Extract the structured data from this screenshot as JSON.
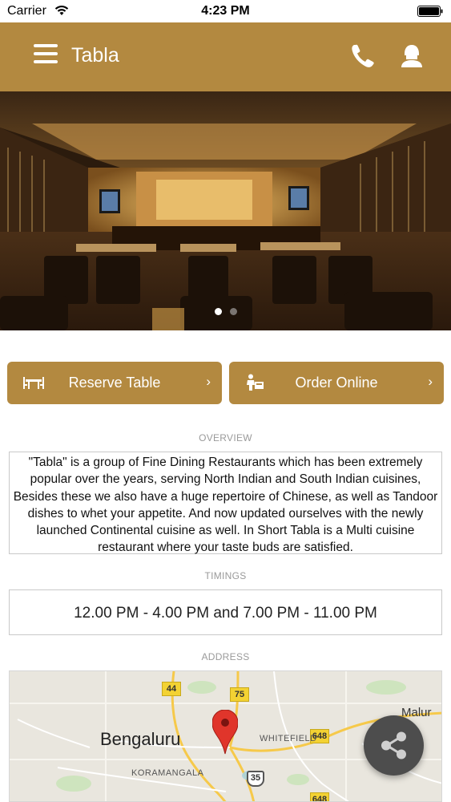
{
  "status_bar": {
    "carrier": "Carrier",
    "time": "4:23 PM"
  },
  "header": {
    "title": "Tabla",
    "icons": {
      "menu": "hamburger-menu-icon",
      "phone": "phone-icon",
      "profile": "profile-icon"
    }
  },
  "hero": {
    "slides": 2,
    "active_slide": 1
  },
  "actions": {
    "reserve_label": "Reserve Table",
    "order_label": "Order Online",
    "chevron": "›"
  },
  "sections": {
    "overview_label": "OVERVIEW",
    "overview_text": "\"Tabla\" is a group of Fine Dining Restaurants which has been extremely popular over the years, serving North Indian and South Indian cuisines, Besides these we also have a huge repertoire of Chinese, as well as Tandoor dishes to whet your appetite. And now updated ourselves with the newly launched Continental cuisine as well. In Short Tabla is a Multi cuisine restaurant where your taste buds are satisfied.",
    "timings_label": "TIMINGS",
    "timings_text": "12.00 PM - 4.00 PM and 7.00 PM - 11.00 PM",
    "address_label": "ADDRESS"
  },
  "map": {
    "city": "Bengaluru",
    "areas": [
      "WHITEFIELD",
      "KORAMANGALA"
    ],
    "town": "Malur",
    "roads": [
      "44",
      "75",
      "648",
      "35",
      "648"
    ]
  },
  "colors": {
    "brand": "#b38940",
    "fab": "#4d4d4d",
    "pin": "#e0352b"
  }
}
